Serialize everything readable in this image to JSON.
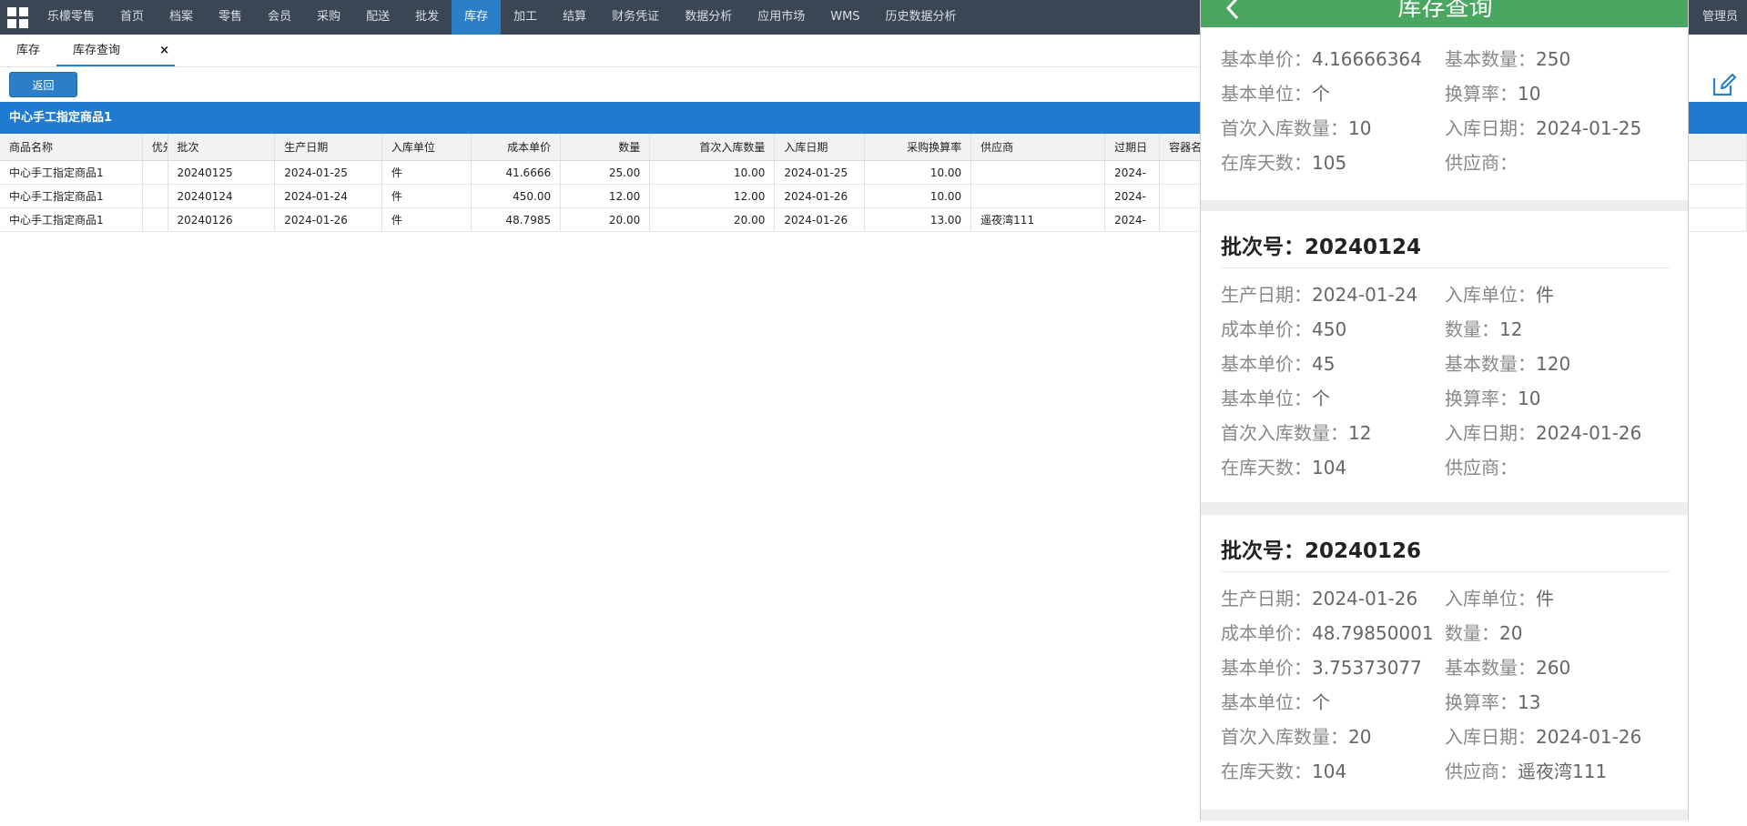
{
  "nav": {
    "items": [
      "乐檬零售",
      "首页",
      "档案",
      "零售",
      "会员",
      "采购",
      "配送",
      "批发",
      "库存",
      "加工",
      "结算",
      "财务凭证",
      "数据分析",
      "应用市场",
      "WMS",
      "历史数据分析"
    ],
    "active_index": 8,
    "user": "管理员"
  },
  "tabs": {
    "items": [
      "库存",
      "库存查询"
    ],
    "close_glyph": "×"
  },
  "toolbar": {
    "back_label": "返回"
  },
  "product_bar": {
    "title": "中心手工指定商品1"
  },
  "table": {
    "headers": [
      "商品名称",
      "优先",
      "批次",
      "生产日期",
      "入库单位",
      "成本单价",
      "数量",
      "首次入库数量",
      "入库日期",
      "采购换算率",
      "供应商",
      "过期日",
      "容器名称"
    ],
    "rows": [
      [
        "中心手工指定商品1",
        "",
        "20240125",
        "2024-01-25",
        "件",
        "41.6666",
        "25.00",
        "10.00",
        "2024-01-25",
        "10.00",
        "",
        "2024-"
      ],
      [
        "中心手工指定商品1",
        "",
        "20240124",
        "2024-01-24",
        "件",
        "450.00",
        "12.00",
        "12.00",
        "2024-01-26",
        "10.00",
        "",
        "2024-"
      ],
      [
        "中心手工指定商品1",
        "",
        "20240126",
        "2024-01-26",
        "件",
        "48.7985",
        "20.00",
        "20.00",
        "2024-01-26",
        "13.00",
        "遥夜湾111",
        "2024-"
      ]
    ]
  },
  "mobile": {
    "title": "库存查询",
    "partial_card": {
      "rows": [
        [
          {
            "k": "基本单价：",
            "v": "4.16666364"
          },
          {
            "k": "基本数量：",
            "v": "250"
          }
        ],
        [
          {
            "k": "基本单位：",
            "v": "个"
          },
          {
            "k": "换算率：",
            "v": "10"
          }
        ],
        [
          {
            "k": "首次入库数量：",
            "v": "10"
          },
          {
            "k": "入库日期：",
            "v": "2024-01-25"
          }
        ],
        [
          {
            "k": "在库天数：",
            "v": "105"
          },
          {
            "k": "供应商：",
            "v": ""
          }
        ]
      ]
    },
    "cards": [
      {
        "batch_label": "批次号：",
        "batch": "20240124",
        "rows": [
          [
            {
              "k": "生产日期：",
              "v": "2024-01-24"
            },
            {
              "k": "入库单位：",
              "v": "件"
            }
          ],
          [
            {
              "k": "成本单价：",
              "v": "450"
            },
            {
              "k": "数量：",
              "v": "12"
            }
          ],
          [
            {
              "k": "基本单价：",
              "v": "45"
            },
            {
              "k": "基本数量：",
              "v": "120"
            }
          ],
          [
            {
              "k": "基本单位：",
              "v": "个"
            },
            {
              "k": "换算率：",
              "v": "10"
            }
          ],
          [
            {
              "k": "首次入库数量：",
              "v": "12"
            },
            {
              "k": "入库日期：",
              "v": "2024-01-26"
            }
          ],
          [
            {
              "k": "在库天数：",
              "v": "104"
            },
            {
              "k": "供应商：",
              "v": ""
            }
          ]
        ]
      },
      {
        "batch_label": "批次号：",
        "batch": "20240126",
        "rows": [
          [
            {
              "k": "生产日期：",
              "v": "2024-01-26"
            },
            {
              "k": "入库单位：",
              "v": "件"
            }
          ],
          [
            {
              "k": "成本单价：",
              "v": "48.79850001"
            },
            {
              "k": "数量：",
              "v": "20"
            }
          ],
          [
            {
              "k": "基本单价：",
              "v": "3.75373077"
            },
            {
              "k": "基本数量：",
              "v": "260"
            }
          ],
          [
            {
              "k": "基本单位：",
              "v": "个"
            },
            {
              "k": "换算率：",
              "v": "13"
            }
          ],
          [
            {
              "k": "首次入库数量：",
              "v": "20"
            },
            {
              "k": "入库日期：",
              "v": "2024-01-26"
            }
          ],
          [
            {
              "k": "在库天数：",
              "v": "104"
            },
            {
              "k": "供应商：",
              "v": "遥夜湾111"
            }
          ]
        ]
      }
    ]
  },
  "colors": {
    "nav_bg": "#3a4654",
    "accent": "#2a7fc7",
    "product_bar": "#1e7bd0",
    "mobile_header": "#4aa760"
  },
  "icons": [
    "app-grid-icon",
    "close-icon",
    "edit-icon",
    "chevron-left-icon"
  ]
}
